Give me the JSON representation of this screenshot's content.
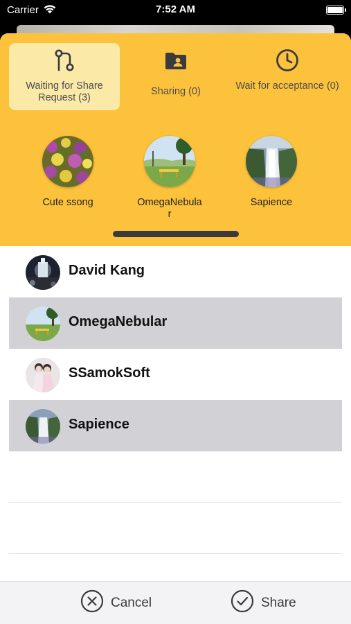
{
  "status_bar": {
    "carrier": "Carrier",
    "time": "7:52 AM",
    "wifi_icon": "wifi-icon",
    "battery_icon": "battery-icon"
  },
  "tabs": [
    {
      "label": "Waiting for Share Request (3)",
      "icon": "branch-icon",
      "active": true
    },
    {
      "label": "Sharing (0)",
      "icon": "folder-user-icon",
      "active": false
    },
    {
      "label": "Wait for acceptance (0)",
      "icon": "clock-icon",
      "active": false
    }
  ],
  "favorites": [
    {
      "name": "Cute ssong"
    },
    {
      "name": "OmegaNebular"
    },
    {
      "name": "Sapience"
    }
  ],
  "contacts": [
    {
      "name": "David Kang",
      "selected": false
    },
    {
      "name": "OmegaNebular",
      "selected": true
    },
    {
      "name": "SSamokSoft",
      "selected": false
    },
    {
      "name": "Sapience",
      "selected": true
    }
  ],
  "toolbar": {
    "cancel_label": "Cancel",
    "share_label": "Share"
  },
  "colors": {
    "header_bg": "#fcc23c",
    "active_tab_bg": "#fbe9a8",
    "selected_row_bg": "#d1d1d6",
    "toolbar_bg": "#f3f3f5"
  }
}
